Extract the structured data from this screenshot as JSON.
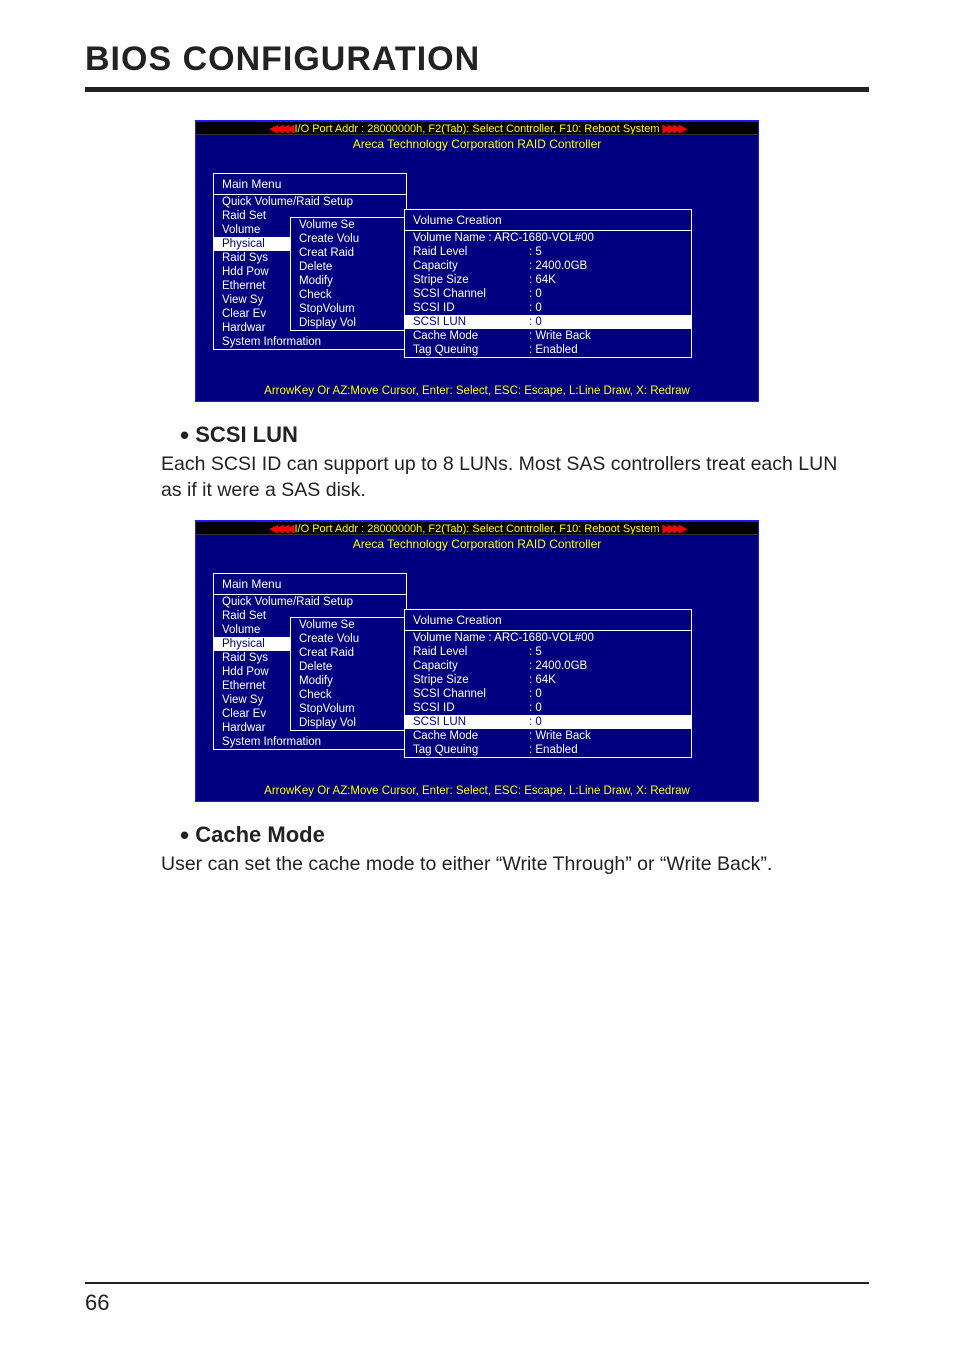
{
  "page": {
    "title": "BIOS CONFIGURATION",
    "number": "66"
  },
  "bios_common": {
    "header_banner": "I/O Port Addr : 28000000h, F2(Tab): Select Controller, F10: Reboot System",
    "subheader": "Areca Technology Corporation RAID Controller",
    "footer": "ArrowKey Or AZ:Move Cursor, Enter: Select, ESC: Escape, L:Line Draw, X: Redraw",
    "main_menu_title": "Main Menu",
    "main_menu_items": [
      "Quick Volume/Raid Setup",
      "Raid Set",
      "Volume",
      "Physical",
      "Raid Sys",
      "Hdd Pow",
      "Ethernet",
      "View Sy",
      "Clear Ev",
      "Hardwar",
      "System Information"
    ],
    "volume_menu_items": [
      "Volume Se",
      "Create Volu",
      "Creat Raid",
      "Delete",
      "Modify",
      "Check",
      "StopVolum",
      "Display Vol"
    ],
    "vc_title": "Volume Creation",
    "vc_rows": [
      {
        "label": "Volume Name",
        "value": ": ARC-1680-VOL#00",
        "key": "volume_name"
      },
      {
        "label": "Raid Level",
        "value": ":  5",
        "key": "raid_level"
      },
      {
        "label": "Capacity",
        "value": ":  2400.0GB",
        "key": "capacity"
      },
      {
        "label": "Stripe Size",
        "value": ":  64K",
        "key": "stripe_size"
      },
      {
        "label": "SCSI  Channel",
        "value": ":  0",
        "key": "scsi_channel"
      },
      {
        "label": "SCSI  ID",
        "value": ":  0",
        "key": "scsi_id"
      },
      {
        "label": "SCSI  LUN",
        "value": ":  0",
        "key": "scsi_lun"
      },
      {
        "label": "Cache Mode",
        "value": ":   Write Back",
        "key": "cache_mode"
      },
      {
        "label": "Tag Queuing",
        "value": ":   Enabled",
        "key": "tag_queuing"
      }
    ]
  },
  "screens": [
    {
      "highlight_key": "scsi_lun"
    },
    {
      "highlight_key": "scsi_lun"
    }
  ],
  "sections": [
    {
      "heading": "SCSI LUN",
      "body": "Each SCSI ID can support up to 8 LUNs. Most SAS controllers treat each LUN as if it were a SAS disk."
    },
    {
      "heading": "Cache Mode",
      "body": "User can set the cache mode to either “Write Through” or “Write Back”."
    }
  ]
}
